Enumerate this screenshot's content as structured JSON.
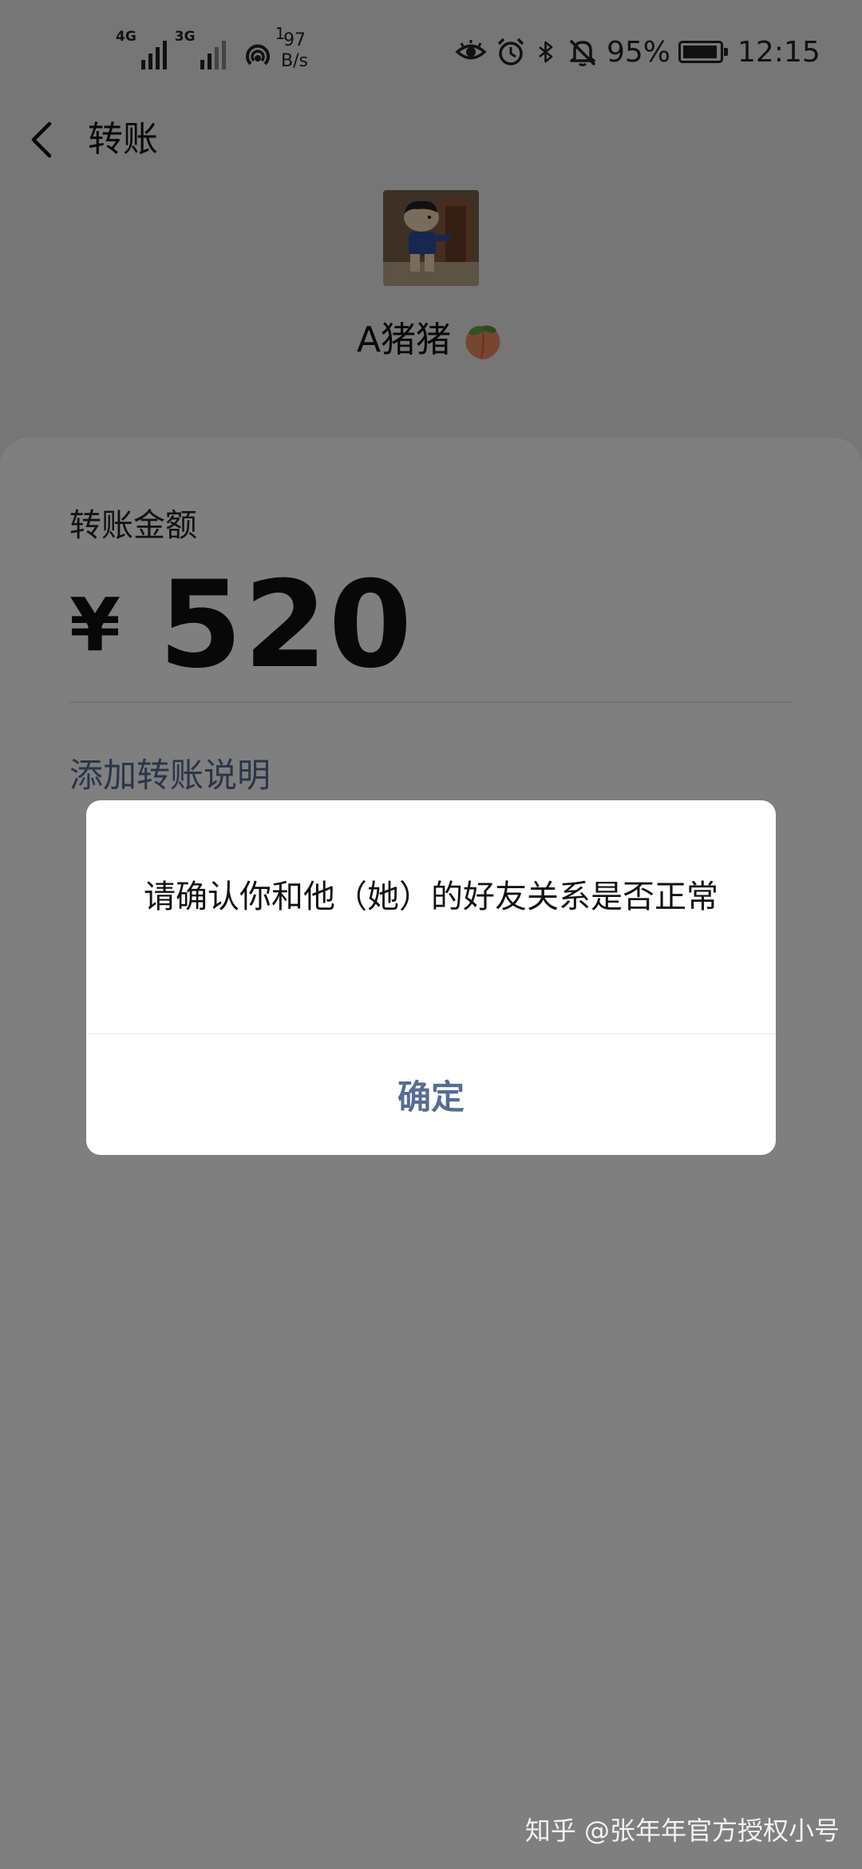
{
  "status_bar": {
    "network_1": "4G",
    "network_2": "3G",
    "hotspot_superscript": "1",
    "speed_value": "97",
    "speed_unit": "B/s",
    "battery_percent": "95%",
    "battery_level": 0.95,
    "time": "12:15",
    "icons": [
      "eye-comfort-icon",
      "alarm-icon",
      "bluetooth-icon",
      "mute-icon"
    ]
  },
  "nav": {
    "title": "转账",
    "back_icon": "chevron-left-icon"
  },
  "recipient": {
    "name": "A猪猪",
    "emoji_icon": "peach-icon"
  },
  "transfer": {
    "amount_label": "转账金额",
    "currency_symbol": "¥",
    "amount": "520",
    "add_note_label": "添加转账说明"
  },
  "dialog": {
    "message": "请确认你和他（她）的好友关系是否正常",
    "confirm_label": "确定"
  },
  "watermark": "知乎 @张年年官方授权小号",
  "colors": {
    "link": "#576b95",
    "overlay": "rgba(0,0,0,0.5)",
    "background": "#ededed"
  }
}
